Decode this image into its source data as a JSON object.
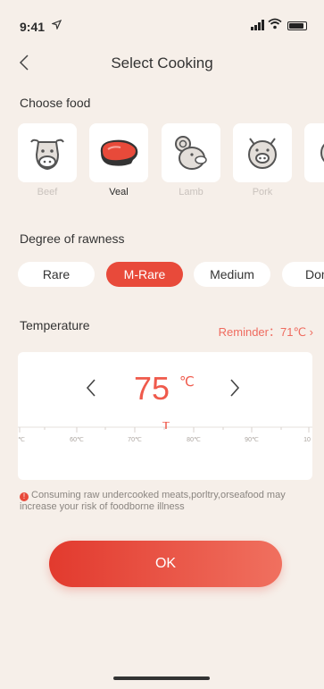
{
  "status_bar": {
    "time": "9:41",
    "location_arrow": "location-arrow-icon"
  },
  "nav": {
    "title": "Select Cooking",
    "back_icon": "chevron-left-icon"
  },
  "food_section": {
    "title": "Choose food",
    "items": [
      {
        "label": "Beef",
        "icon": "cow-icon",
        "selected": false
      },
      {
        "label": "Veal",
        "icon": "steak-icon",
        "selected": true
      },
      {
        "label": "Lamb",
        "icon": "ram-icon",
        "selected": false
      },
      {
        "label": "Pork",
        "icon": "pig-icon",
        "selected": false
      }
    ]
  },
  "rawness_section": {
    "title": "Degree of rawness",
    "options": [
      {
        "label": "Rare",
        "selected": false
      },
      {
        "label": "M-Rare",
        "selected": true
      },
      {
        "label": "Medium",
        "selected": false
      },
      {
        "label": "Don",
        "selected": false
      }
    ]
  },
  "temperature": {
    "title": "Temperature",
    "reminder": "Reminder：71℃ ›",
    "value": "75",
    "unit": "℃",
    "scale_labels": [
      "℃",
      "60℃",
      "70℃",
      "80℃",
      "90℃",
      "10"
    ]
  },
  "warning": {
    "text": "Consuming raw undercooked meats,porltry,orseafood may increase your risk of foodborne illness"
  },
  "ok_button": {
    "label": "OK"
  },
  "colors": {
    "accent": "#e84a3a",
    "background": "#f6efe9",
    "temperature": "#ef5a4c"
  }
}
